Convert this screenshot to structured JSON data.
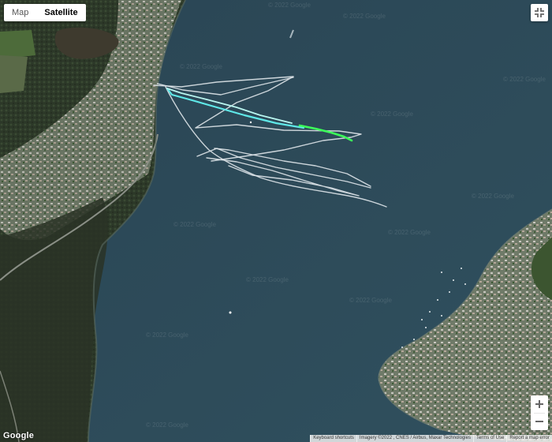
{
  "map_type": {
    "buttons": [
      {
        "label": "Map",
        "active": false
      },
      {
        "label": "Satellite",
        "active": true
      }
    ]
  },
  "controls": {
    "fullscreen_icon": "fullscreen-exit-icon",
    "zoom_in_icon": "plus-icon",
    "zoom_out_icon": "minus-icon"
  },
  "logo": "Google",
  "watermark_text": "© 2022 Google",
  "attribution": {
    "shortcuts": "Keyboard shortcuts",
    "imagery": "Imagery ©2022 , CNES / Airbus, Maxar Technologies",
    "terms": "Terms of Use",
    "report": "Report a map error"
  },
  "colors": {
    "water": "#2b4a5a",
    "land_dark": "#2f3b2c",
    "track_white": "#dfe6ea",
    "track_cyan": "#5fe8e8",
    "track_green": "#3cff5a"
  }
}
